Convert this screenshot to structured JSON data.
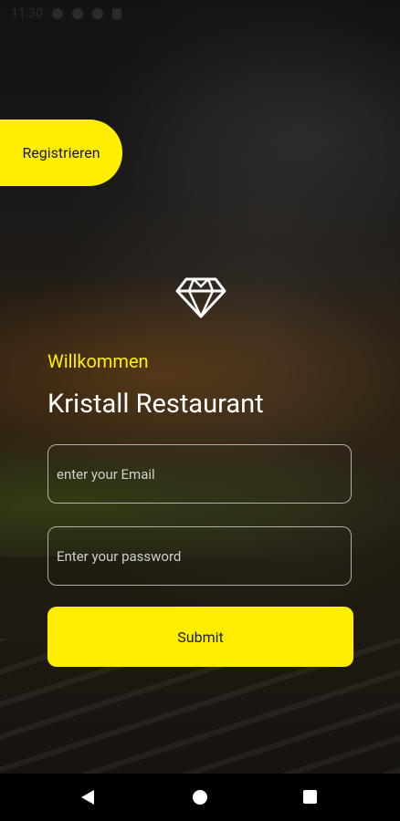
{
  "status_bar": {
    "time": "11:30"
  },
  "register_button": {
    "label": "Registrieren"
  },
  "logo": {
    "icon": "diamond-logo-icon"
  },
  "welcome": {
    "text": "Willkommen"
  },
  "title": {
    "text": "Kristall Restaurant"
  },
  "email_field": {
    "placeholder": "enter your Email",
    "value": ""
  },
  "password_field": {
    "placeholder": "Enter your password",
    "value": ""
  },
  "submit_button": {
    "label": "Submit"
  },
  "colors": {
    "accent": "#ffee00",
    "text_light": "#ffffff",
    "navbar": "#000000"
  },
  "nav": {
    "back_icon": "back-triangle-icon",
    "home_icon": "home-circle-icon",
    "recents_icon": "recents-square-icon"
  }
}
